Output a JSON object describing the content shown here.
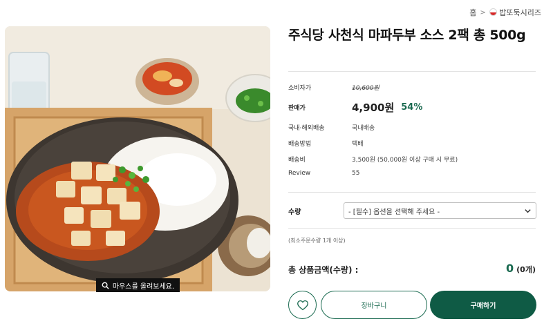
{
  "breadcrumb": {
    "home": "홈",
    "separator": ">",
    "category": "밥또둑시리즈"
  },
  "product": {
    "title": "주식당 사천식 마파두부 소스 2팩 총 500g",
    "image_hint": "마우스를 올려보세요."
  },
  "details": {
    "consumer_price": {
      "label": "소비자가",
      "value": "10,600원"
    },
    "sale_price": {
      "label": "판매가",
      "value": "4,900원",
      "discount": "54%"
    },
    "shipping_region": {
      "label": "국내·해외배송",
      "value": "국내배송"
    },
    "shipping_method": {
      "label": "배송방법",
      "value": "택배"
    },
    "shipping_fee": {
      "label": "배송비",
      "value": "3,500원 (50,000원 이상 구매 시 무료)"
    },
    "review": {
      "label": "Review",
      "value": "55"
    }
  },
  "quantity": {
    "label": "수량",
    "select_value": "- [필수] 옵션을 선택해 주세요 -",
    "minimum_note": "(최소주문수량 1개 이상)"
  },
  "total": {
    "label": "총 상품금액(수량) :",
    "amount": "0",
    "count": "(0개)"
  },
  "actions": {
    "cart_label": "장바구니",
    "buy_label": "구매하기"
  },
  "colors": {
    "accent": "#0f5b45",
    "discount": "#1a6a50",
    "flag_red": "#d62828"
  },
  "icons": [
    "flag-icon",
    "search-icon",
    "chevron-down-icon",
    "heart-icon"
  ]
}
